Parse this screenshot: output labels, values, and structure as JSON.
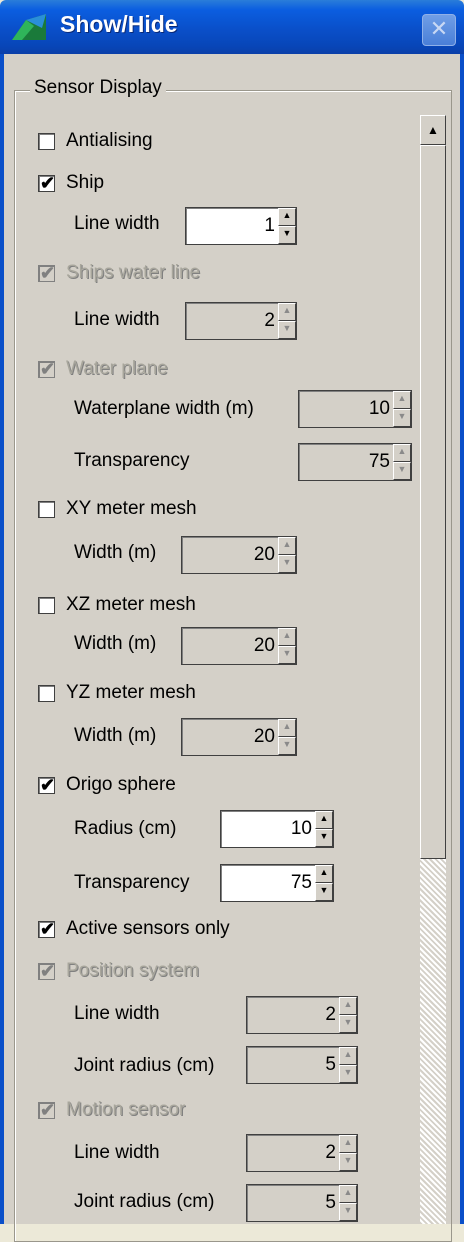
{
  "window": {
    "title": "Show/Hide"
  },
  "group": {
    "legend": "Sensor Display"
  },
  "items": {
    "antialising": {
      "label": "Antialising",
      "checked": false,
      "enabled": true
    },
    "ship": {
      "label": "Ship",
      "checked": true,
      "enabled": true,
      "line_width_label": "Line width",
      "line_width": "1"
    },
    "ships_water_line": {
      "label": "Ships water line",
      "checked": true,
      "enabled": false,
      "line_width_label": "Line width",
      "line_width": "2"
    },
    "water_plane": {
      "label": "Water plane",
      "checked": true,
      "enabled": false,
      "width_label": "Waterplane width (m)",
      "width": "10",
      "transparency_label": "Transparency",
      "transparency": "75"
    },
    "xy_mesh": {
      "label": "XY meter mesh",
      "checked": false,
      "enabled": true,
      "width_label": "Width (m)",
      "width": "20"
    },
    "xz_mesh": {
      "label": "XZ meter mesh",
      "checked": false,
      "enabled": true,
      "width_label": "Width (m)",
      "width": "20"
    },
    "yz_mesh": {
      "label": "YZ meter mesh",
      "checked": false,
      "enabled": true,
      "width_label": "Width (m)",
      "width": "20"
    },
    "origo_sphere": {
      "label": "Origo sphere",
      "checked": true,
      "enabled": true,
      "radius_label": "Radius (cm)",
      "radius": "10",
      "transparency_label": "Transparency",
      "transparency": "75"
    },
    "active_sensors": {
      "label": "Active sensors only",
      "checked": true,
      "enabled": true
    },
    "position_system": {
      "label": "Position system",
      "checked": true,
      "enabled": false,
      "line_width_label": "Line width",
      "line_width": "2",
      "joint_radius_label": "Joint radius (cm)",
      "joint_radius": "5"
    },
    "motion_sensor": {
      "label": "Motion sensor",
      "checked": true,
      "enabled": false,
      "line_width_label": "Line width",
      "line_width": "2",
      "joint_radius_label": "Joint radius (cm)",
      "joint_radius": "5"
    }
  },
  "glyphs": {
    "check": "✔",
    "up": "▲",
    "down": "▼",
    "close": "✕"
  }
}
